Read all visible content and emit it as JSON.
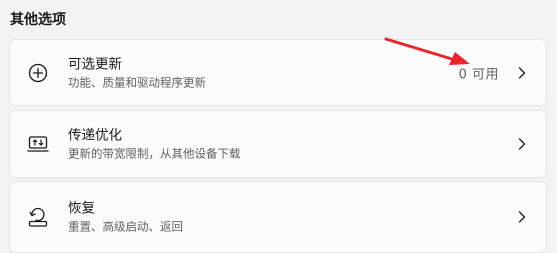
{
  "section": {
    "title": "其他选项"
  },
  "cards": [
    {
      "title": "可选更新",
      "subtitle": "功能、质量和驱动程序更新",
      "value": "0 可用",
      "icon": "plus-circle-icon"
    },
    {
      "title": "传递优化",
      "subtitle": "更新的带宽限制，从其他设备下载",
      "icon": "delivery-optimization-icon"
    },
    {
      "title": "恢复",
      "subtitle": "重置、高级启动、返回",
      "icon": "recovery-icon"
    }
  ],
  "colors": {
    "background": "#f3f3f3",
    "card": "#fbfbfb",
    "annotation_arrow": "#e8262b"
  }
}
